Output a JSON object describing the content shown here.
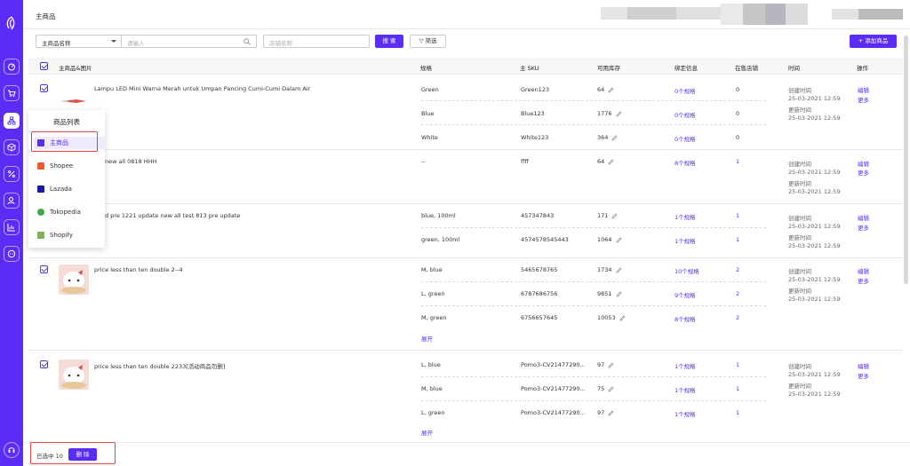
{
  "page": {
    "title": "主商品"
  },
  "filters": {
    "field_select": "主商品名称",
    "search_placeholder": "请输入",
    "shop_placeholder": "店铺名称",
    "search_button": "搜 索",
    "filter_button": "筛选",
    "add_button": "+ 添加商品"
  },
  "table": {
    "headers": [
      "主商品&图片",
      "规格",
      "主 SKU",
      "可用库存",
      "绑定信息",
      "在售店铺",
      "时间",
      "操作"
    ]
  },
  "time_labels": {
    "created": "创建时间",
    "updated": "更新时间"
  },
  "actions": {
    "edit": "编辑",
    "more": "更多",
    "expand": "展开"
  },
  "products": [
    {
      "name": "Lampu LED Mini Warna Merah untuk Umpan Pancing Cumi-Cumi Dalam Air",
      "created": "25-03-2021 12:59",
      "updated": "25-03-2021 12:59",
      "variants": [
        {
          "spec": "Green",
          "sku": "Green123",
          "stock": "64",
          "bind": "0个规格",
          "stores": "0"
        },
        {
          "spec": "Blue",
          "sku": "Blue123",
          "stock": "1776",
          "bind": "0个规格",
          "stores": "0"
        },
        {
          "spec": "White",
          "sku": "White123",
          "stock": "364",
          "bind": "0个规格",
          "stores": "0"
        }
      ]
    },
    {
      "name": "new all 0818 HHH",
      "created": "25-03-2021 12:59",
      "updated": "25-03-2021 12:59",
      "variants": [
        {
          "spec": "--",
          "sku": "ffff",
          "stock": "64",
          "bind": "8个规格",
          "stores": "1"
        }
      ]
    },
    {
      "name": "d pre 1221 update new all test 813 pre update",
      "created": "25-03-2021 12:59",
      "updated": "25-03-2021 12:59",
      "variants": [
        {
          "spec": "blue, 100ml",
          "sku": "457347843",
          "stock": "171",
          "bind": "1个规格",
          "stores": "1"
        },
        {
          "spec": "green, 100ml",
          "sku": "4574578545443",
          "stock": "1064",
          "bind": "1个规格",
          "stores": "1"
        }
      ]
    },
    {
      "name": "price less than ten double 2--4",
      "created": "25-03-2021 12:59",
      "updated": "25-03-2021 12:59",
      "variants": [
        {
          "spec": "M, blue",
          "sku": "5465678765",
          "stock": "1734",
          "bind": "10个规格",
          "stores": "2"
        },
        {
          "spec": "L, green",
          "sku": "6787686756",
          "stock": "9851",
          "bind": "9个规格",
          "stores": "2"
        },
        {
          "spec": "M, green",
          "sku": "6756657645",
          "stock": "10053",
          "bind": "8个规格",
          "stores": "2"
        }
      ]
    },
    {
      "name": "price less than ten double 2233[活动商品勿删]",
      "created": "25-03-2021 12:59",
      "updated": "25-03-2021 12:59",
      "variants": [
        {
          "spec": "L, blue",
          "sku": "Pomo3-CV21477290...",
          "stock": "97",
          "bind": "1个规格",
          "stores": "1"
        },
        {
          "spec": "M, blue",
          "sku": "Pomo3-CV21477290...",
          "stock": "75",
          "bind": "1个规格",
          "stores": "1"
        },
        {
          "spec": "L, green",
          "sku": "Pomo3-CV21477290...",
          "stock": "97",
          "bind": "1个规格",
          "stores": "1"
        }
      ]
    }
  ],
  "dropdown": {
    "title": "商品列表",
    "items": [
      "主商品",
      "Shopee",
      "Lazada",
      "Tokopedia",
      "Shopify"
    ]
  },
  "bottom": {
    "selected": "已选中 10",
    "delete_button": "删 除"
  },
  "colors": {
    "accent": "#5b2cf6",
    "highlight": "#e83f3f"
  }
}
